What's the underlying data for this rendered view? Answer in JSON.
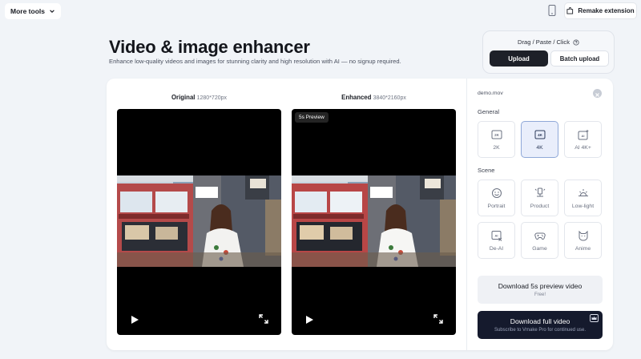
{
  "topbar": {
    "more_tools": "More tools",
    "remake_extension": "Remake extension"
  },
  "hero": {
    "title": "Video & image enhancer",
    "subtitle": "Enhance low-quality videos and images for stunning clarity and high resolution with AI — no signup required."
  },
  "upload": {
    "title": "Drag / Paste / Click",
    "upload_label": "Upload",
    "batch_label": "Batch upload"
  },
  "compare": {
    "original_label": "Original",
    "original_res": "1280*720px",
    "enhanced_label": "Enhanced",
    "enhanced_res": "3840*2160px",
    "preview_tag": "5s Preview"
  },
  "panel": {
    "filename": "demo.mov",
    "general_title": "General",
    "general_options": [
      {
        "label": "2K",
        "icon": "2k-icon",
        "selected": false
      },
      {
        "label": "4K",
        "icon": "4k-icon",
        "selected": true
      },
      {
        "label": "AI 4K+",
        "icon": "ai-4k-icon",
        "selected": false
      }
    ],
    "scene_title": "Scene",
    "scene_options": [
      {
        "label": "Portrait",
        "icon": "smile-face-icon"
      },
      {
        "label": "Product",
        "icon": "product-stand-icon"
      },
      {
        "label": "Low-light",
        "icon": "sunrise-icon"
      },
      {
        "label": "De-AI",
        "icon": "de-ai-icon"
      },
      {
        "label": "Game",
        "icon": "gamepad-icon"
      },
      {
        "label": "Anime",
        "icon": "anime-cat-icon"
      }
    ],
    "download_preview": {
      "title": "Download 5s preview video",
      "subtitle": "Free!"
    },
    "download_full": {
      "title": "Download full video",
      "subtitle": "Subscribe to Vmake Pro for continued use."
    }
  },
  "colors": {
    "background": "#f1f4f8",
    "primary_dark": "#1d2028",
    "full_download_bg": "#151a2d",
    "selected_option_bg": "#e9eefb"
  }
}
